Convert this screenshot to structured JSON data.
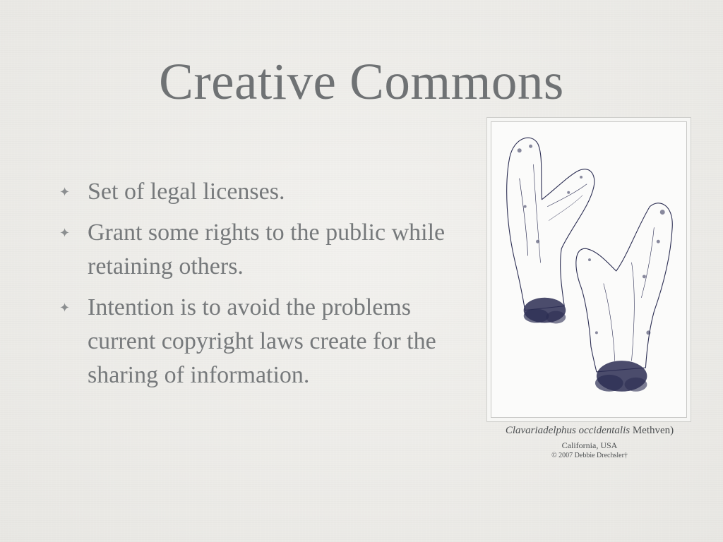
{
  "slide": {
    "title": "Creative Commons",
    "bullet_glyph": "✦",
    "bullets": [
      {
        "text": "Set of legal licenses."
      },
      {
        "text": "Grant some rights to the public while retaining others."
      },
      {
        "text": "Intention is to avoid the problems current copyright laws create for the sharing of information."
      }
    ]
  },
  "figure": {
    "illustration": "mushroom-sketch",
    "caption": {
      "species": "Clavariadelphus occidentalis",
      "author": " Methven)",
      "location": "California, USA",
      "credit": "© 2007 Debbie Drechsler†"
    }
  },
  "colors": {
    "background": "#ecebe7",
    "title": "#6f7274",
    "body_text": "#76797b",
    "ink": "#2b2d52"
  }
}
